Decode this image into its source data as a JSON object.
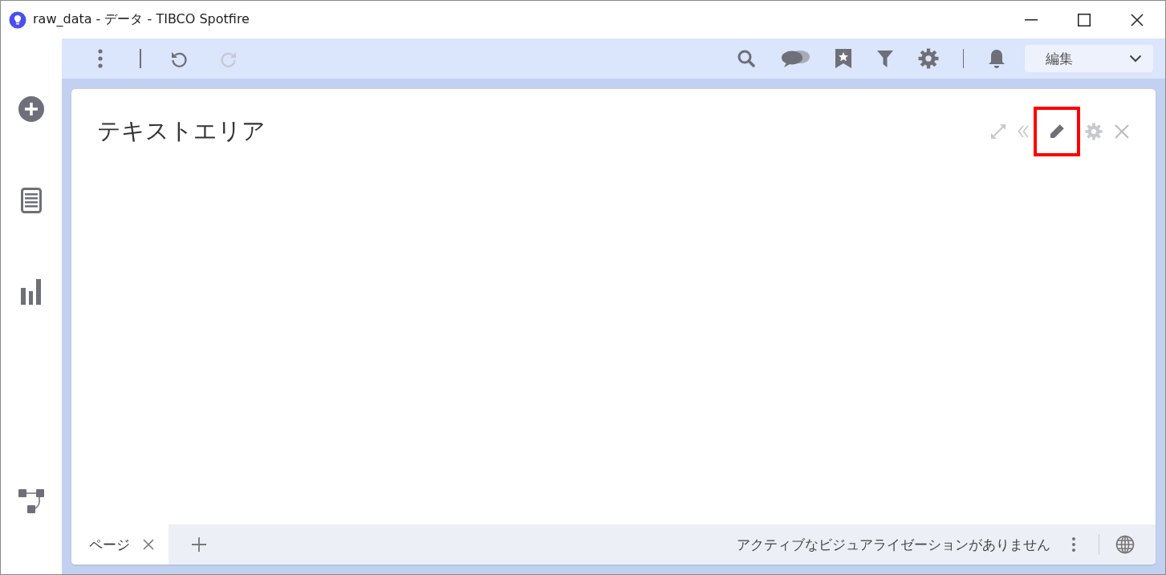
{
  "window": {
    "title": "raw_data - データ - TIBCO Spotfire"
  },
  "toolbar": {
    "mode_dropdown": {
      "value": "編集"
    }
  },
  "panel": {
    "title": "テキストエリア",
    "tools": [
      {
        "kind": "expand",
        "highlighted": false
      },
      {
        "kind": "code",
        "highlighted": false
      },
      {
        "kind": "edit",
        "highlighted": true
      },
      {
        "kind": "settings",
        "highlighted": false
      },
      {
        "kind": "close",
        "highlighted": false
      }
    ]
  },
  "page_tabs": [
    {
      "label": "ページ",
      "selected": true
    }
  ],
  "status_bar": {
    "message": "アクティブなビジュアライゼーションがありません"
  }
}
